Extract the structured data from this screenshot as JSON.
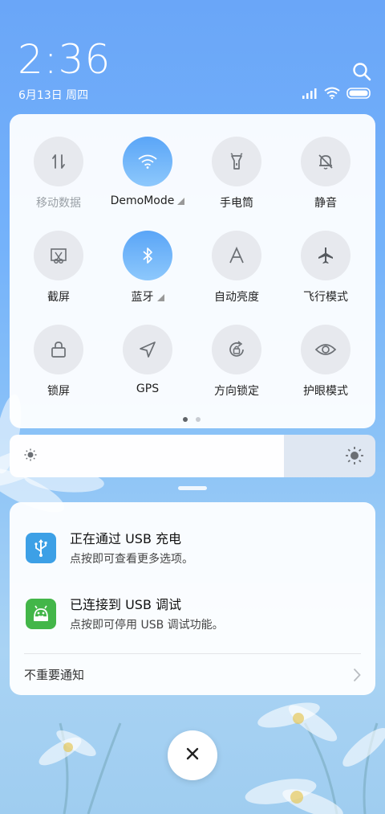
{
  "status_bar": {
    "time": "2:36",
    "date": "6月13日 周四",
    "icons": [
      "search-icon",
      "signal-icon",
      "wifi-icon",
      "battery-icon"
    ]
  },
  "quick_settings": {
    "tiles": [
      {
        "label": "移动数据",
        "icon": "mobile-data-icon",
        "active": false,
        "dim": true
      },
      {
        "label": "DemoMode",
        "icon": "wifi-icon",
        "active": true,
        "expandable": true
      },
      {
        "label": "手电筒",
        "icon": "flashlight-icon",
        "active": false
      },
      {
        "label": "静音",
        "icon": "mute-bell-icon",
        "active": false
      },
      {
        "label": "截屏",
        "icon": "screenshot-icon",
        "active": false
      },
      {
        "label": "蓝牙",
        "icon": "bluetooth-icon",
        "active": true,
        "expandable": true
      },
      {
        "label": "自动亮度",
        "icon": "auto-brightness-icon",
        "active": false
      },
      {
        "label": "飞行模式",
        "icon": "airplane-icon",
        "active": false
      },
      {
        "label": "锁屏",
        "icon": "lock-icon",
        "active": false
      },
      {
        "label": "GPS",
        "icon": "gps-icon",
        "active": false
      },
      {
        "label": "方向锁定",
        "icon": "rotation-lock-icon",
        "active": false
      },
      {
        "label": "护眼模式",
        "icon": "eye-icon",
        "active": false
      }
    ],
    "page_count": 2,
    "current_page": 1
  },
  "brightness": {
    "level": 0.75,
    "icons": [
      "brightness-low-icon",
      "brightness-high-icon"
    ]
  },
  "notifications": {
    "items": [
      {
        "title": "正在通过 USB 充电",
        "subtitle": "点按即可查看更多选项。",
        "icon": "usb-icon",
        "color": "#3da0e6"
      },
      {
        "title": "已连接到 USB 调试",
        "subtitle": "点按即可停用 USB 调试功能。",
        "icon": "android-debug-icon",
        "color": "#43b649"
      }
    ],
    "minor_label": "不重要通知"
  },
  "colors": {
    "active_tile": "#5aa5f7",
    "inactive_tile": "#e7e9ee"
  }
}
